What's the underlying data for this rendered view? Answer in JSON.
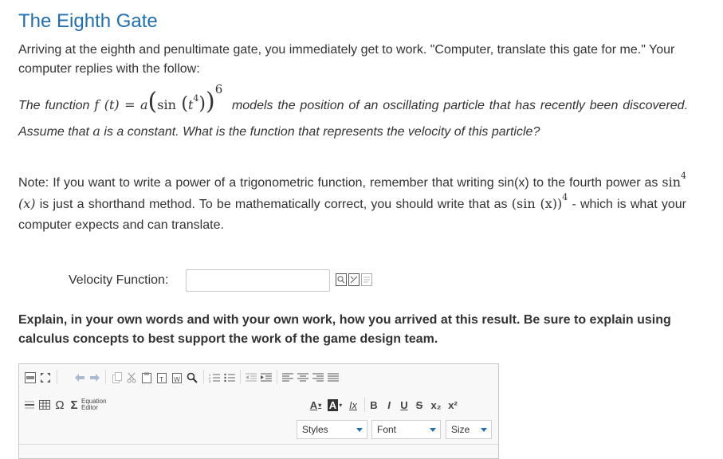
{
  "title": "The Eighth Gate",
  "intro": "Arriving at the eighth and penultimate gate, you immediately get to work. \"Computer, translate this gate for me.\" Your computer replies with the follow:",
  "problem": {
    "lead": "The function",
    "func_lhs": "f (t) = a",
    "sin": "sin",
    "t": "t",
    "inner_exp": "4",
    "outer_exp": "6",
    "tail": "models the position of an oscillating particle that has recently been discovered. Assume that",
    "a": "a",
    "tail2": "is a constant. What is the function that represents the velocity of this particle?"
  },
  "note": {
    "part1": "Note: If you want to write a power of a trigonometric function, remember that writing sin(x) to the fourth power as",
    "sin_short": "sin",
    "short_exp": "4",
    "short_arg": "(x)",
    "part2": "is just a shorthand method. To be mathematically correct, you should write that as",
    "long_form": "(sin (x))",
    "long_exp": "4",
    "part3": "- which is what your computer expects and can translate."
  },
  "velocity": {
    "label": "Velocity Function:",
    "value": ""
  },
  "explain": "Explain, in your own words and with your own work, how you arrived at this result. Be sure to explain using calculus concepts to best support the work of the game design team.",
  "editor": {
    "equation_editor": [
      "Equation",
      "Editor"
    ],
    "font_color": "A",
    "bg_color": "A",
    "clear_format": "Ix",
    "bold": "B",
    "italic": "I",
    "underline": "U",
    "strike": "S",
    "subscript": "x₂",
    "superscript": "x²",
    "omega": "Ω",
    "sigma": "Σ",
    "styles": "Styles",
    "font": "Font",
    "size": "Size"
  },
  "colors": {
    "title": "#1f6fb2",
    "accent": "#1f6fb2"
  }
}
